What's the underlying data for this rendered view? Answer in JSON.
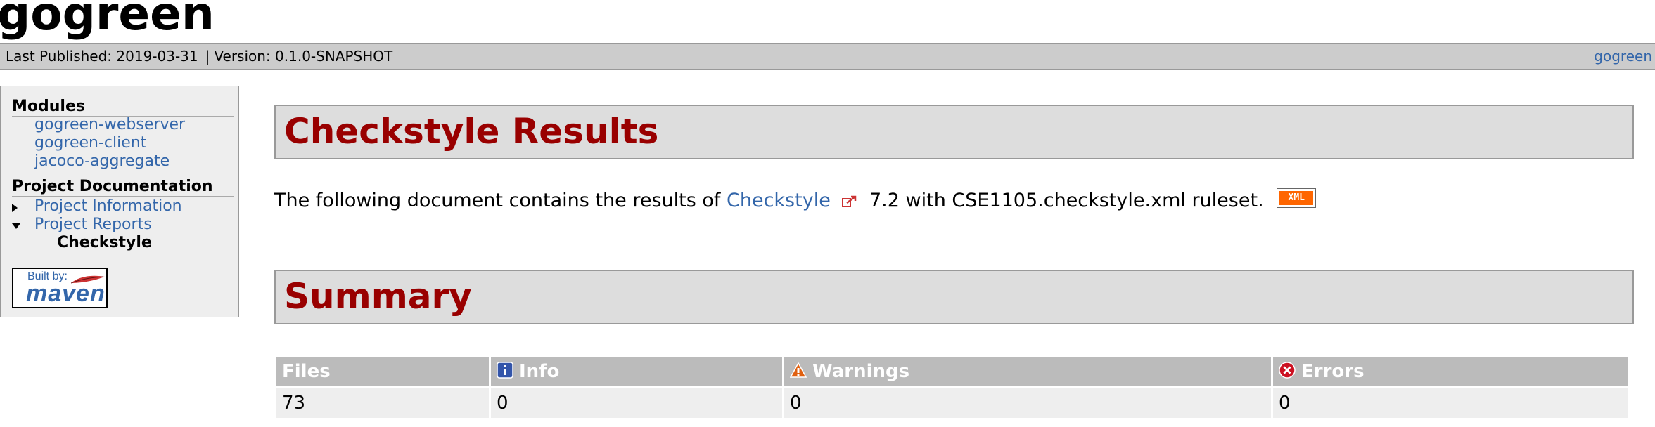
{
  "site": {
    "title": "gogreen"
  },
  "breadcrumbs": {
    "last_published": "Last Published: 2019-03-31",
    "separator": "|",
    "version": "Version: 0.1.0-SNAPSHOT",
    "right_link": "gogreen"
  },
  "menu": {
    "modules_heading": "Modules",
    "modules": [
      "gogreen-webserver",
      "gogreen-client",
      "jacoco-aggregate"
    ],
    "docs_heading": "Project Documentation",
    "project_information": "Project Information",
    "project_reports": "Project Reports",
    "checkstyle": "Checkstyle",
    "badge": {
      "built_by": "Built by:",
      "word": "maven"
    }
  },
  "main": {
    "heading": "Checkstyle Results",
    "intro_prefix": "The following document contains the results of",
    "intro_link": "Checkstyle",
    "intro_suffix": "7.2 with CSE1105.checkstyle.xml ruleset.",
    "xml_badge": "XML",
    "summary_heading": "Summary",
    "table": {
      "headers": [
        "Files",
        "Info",
        "Warnings",
        "Errors"
      ],
      "row": [
        "73",
        "0",
        "0",
        "0"
      ]
    }
  },
  "colors": {
    "heading_red": "#990000",
    "link_blue": "#3366aa",
    "bar_gray": "#cccccc"
  },
  "icons": [
    "external-link-icon",
    "info-icon",
    "warning-icon",
    "error-icon"
  ]
}
